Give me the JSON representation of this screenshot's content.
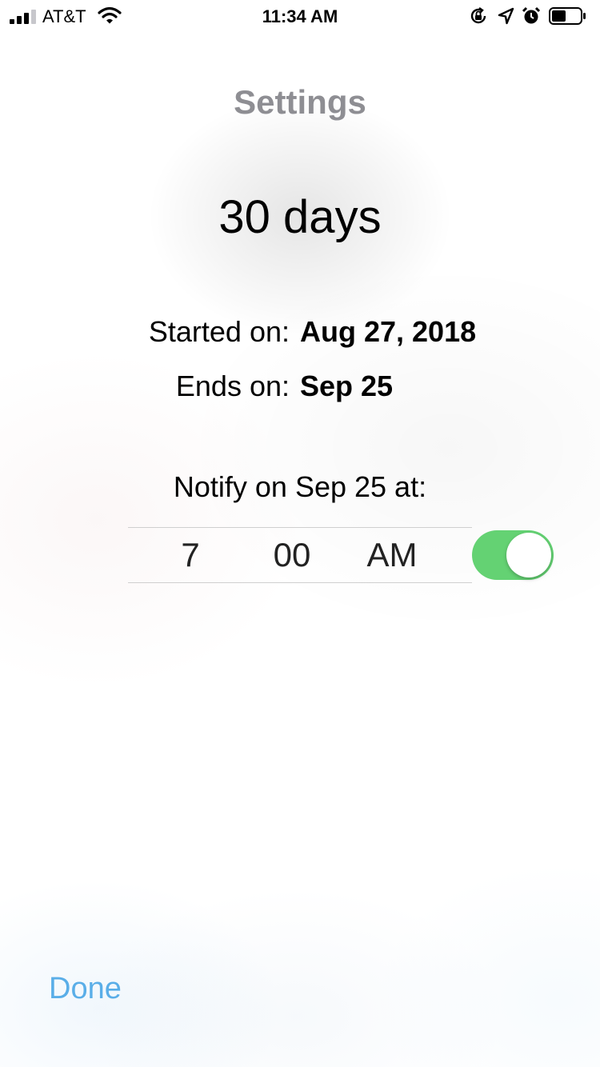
{
  "status_bar": {
    "carrier": "AT&T",
    "time": "11:34 AM",
    "signal_bars_filled": 3,
    "battery_level": 0.5,
    "icons": [
      "signal-icon",
      "wifi-icon",
      "orientation-lock-icon",
      "location-arrow-icon",
      "alarm-icon",
      "battery-icon"
    ]
  },
  "header": {
    "title": "Settings"
  },
  "summary": {
    "duration": "30 days",
    "started_label": "Started on:",
    "started_value": "Aug 27, 2018",
    "ends_label": "Ends on:",
    "ends_value": "Sep 25"
  },
  "notification": {
    "label": "Notify on Sep 25 at:",
    "hour": "7",
    "minute": "00",
    "period": "AM",
    "enabled": true
  },
  "footer": {
    "done_label": "Done"
  },
  "colors": {
    "title_gray": "#8e8e93",
    "toggle_on": "#64d273",
    "link_blue": "#5aaee8",
    "text": "#000000"
  }
}
